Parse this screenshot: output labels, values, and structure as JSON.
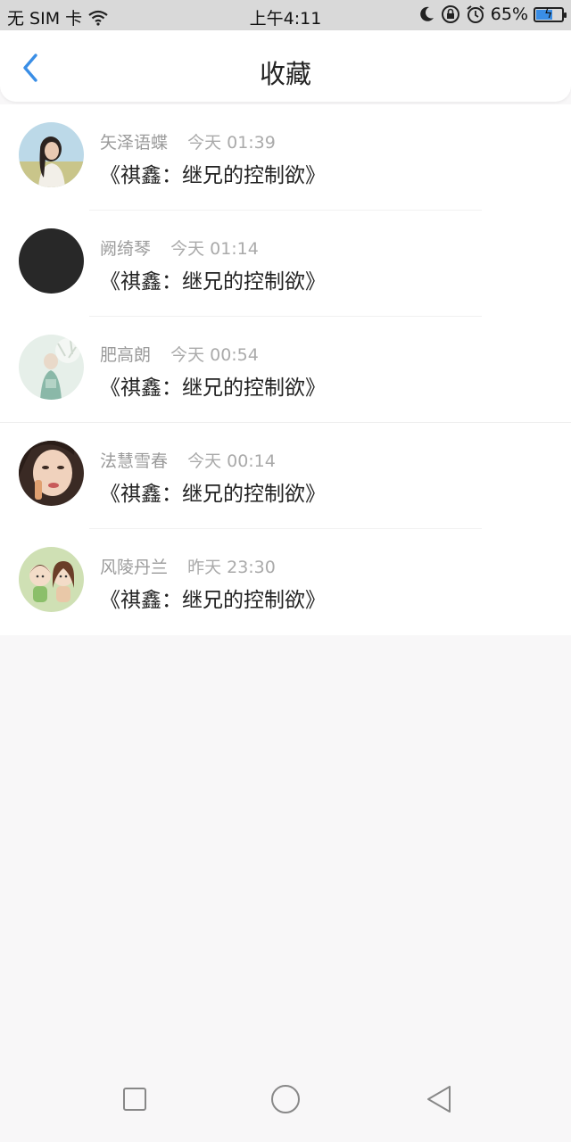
{
  "status_bar": {
    "carrier": "无 SIM 卡",
    "time": "上午4:11",
    "battery": "65%",
    "battery_level": 0.65
  },
  "header": {
    "title": "收藏"
  },
  "list": {
    "items": [
      {
        "username": "矢泽语蝶",
        "time": "今天 01:39",
        "title": "《祺鑫：继兄的控制欲》"
      },
      {
        "username": "阙绮琴",
        "time": "今天 01:14",
        "title": "《祺鑫：继兄的控制欲》"
      },
      {
        "username": "肥高朗",
        "time": "今天 00:54",
        "title": "《祺鑫：继兄的控制欲》"
      },
      {
        "username": "法慧雪春",
        "time": "今天 00:14",
        "title": "《祺鑫：继兄的控制欲》"
      },
      {
        "username": "风陵丹兰",
        "time": "昨天 23:30",
        "title": "《祺鑫：继兄的控制欲》"
      }
    ]
  },
  "icons": {
    "back": "chevron-left-icon",
    "recent": "square-icon",
    "home": "circle-icon",
    "nav_back": "triangle-left-icon"
  },
  "colors": {
    "accent": "#3a8ee6",
    "background": "#f8f7f8"
  }
}
